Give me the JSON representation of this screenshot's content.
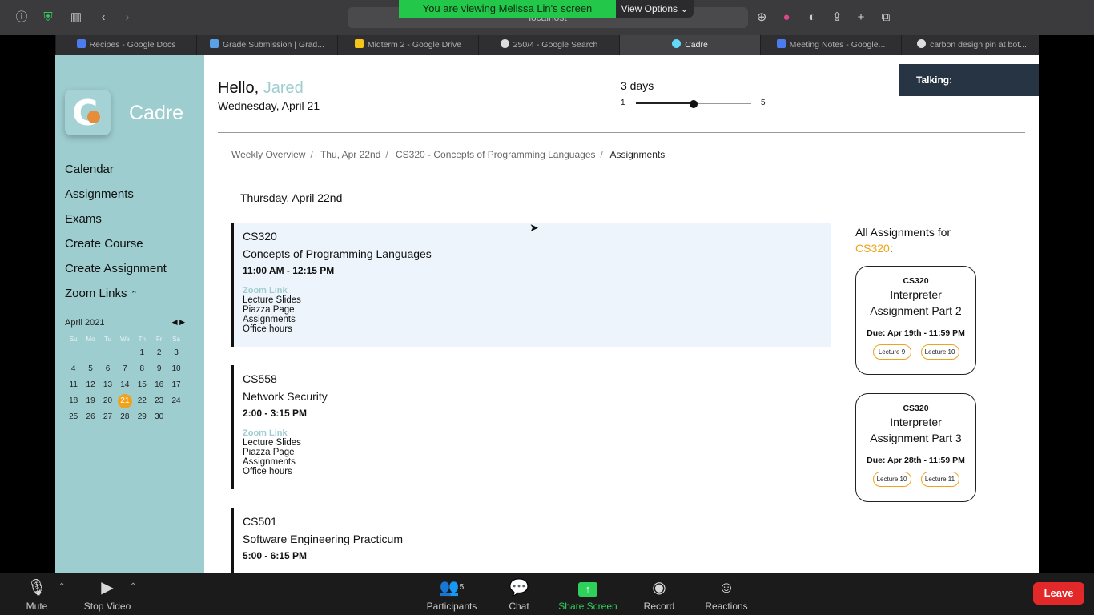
{
  "browser": {
    "url": "localhost",
    "tabs": [
      {
        "label": "Recipes - Google Docs",
        "color": "#4b7bec"
      },
      {
        "label": "Grade Submission | Grad...",
        "color": "#5aa0e6"
      },
      {
        "label": "Midterm 2 - Google Drive",
        "color": "#f5c518"
      },
      {
        "label": "250/4 - Google Search",
        "color": "#dddddd"
      },
      {
        "label": "Cadre",
        "color": "#61dafb"
      },
      {
        "label": "Meeting Notes - Google...",
        "color": "#4b7bec"
      },
      {
        "label": "carbon design pin at bot...",
        "color": "#dddddd"
      }
    ]
  },
  "share_banner": {
    "text": "You are viewing Melissa Lin's screen",
    "view_options": "View Options"
  },
  "app": {
    "brand": "Cadre",
    "greeting": "Hello,",
    "user": "Jared",
    "date": "Wednesday, April 21",
    "days_label": "3 days",
    "slider": {
      "min": "1",
      "max": "5",
      "value": 3
    },
    "talking": "Talking:",
    "nav": [
      "Calendar",
      "Assignments",
      "Exams",
      "Create Course",
      "Create Assignment",
      "Zoom Links"
    ],
    "calendar": {
      "month": "April 2021",
      "weekdays": [
        "Su",
        "Mo",
        "Tu",
        "We",
        "Th",
        "Fr",
        "Sa"
      ],
      "days": [
        "",
        "",
        "",
        "",
        "1",
        "2",
        "3",
        "4",
        "5",
        "6",
        "7",
        "8",
        "9",
        "10",
        "11",
        "12",
        "13",
        "14",
        "15",
        "16",
        "17",
        "18",
        "19",
        "20",
        "21",
        "22",
        "23",
        "24",
        "25",
        "26",
        "27",
        "28",
        "29",
        "30"
      ],
      "selected": "21"
    },
    "breadcrumb": [
      "Weekly Overview",
      "Thu, Apr 22nd",
      "CS320 - Concepts of Programming Languages",
      "Assignments"
    ],
    "day_title": "Thursday, April 22nd",
    "courses": [
      {
        "code": "CS320",
        "name": "Concepts of Programming Languages",
        "time": "11:00 AM - 12:15 PM",
        "zoom": "Zoom Link",
        "links": [
          "Lecture Slides",
          "Piazza Page",
          "Assignments",
          "Office hours"
        ]
      },
      {
        "code": "CS558",
        "name": "Network Security",
        "time": "2:00 - 3:15 PM",
        "zoom": "Zoom Link",
        "links": [
          "Lecture Slides",
          "Piazza Page",
          "Assignments",
          "Office hours"
        ]
      },
      {
        "code": "CS501",
        "name": "Software Engineering Practicum",
        "time": "5:00 - 6:15 PM"
      }
    ],
    "all_assignments": {
      "prefix": "All Assignments for",
      "course": "CS320",
      "suffix": ":"
    },
    "assignments": [
      {
        "code": "CS320",
        "title1": "Interpreter",
        "title2": "Assignment Part 2",
        "due": "Due: Apr 19th - 11:59 PM",
        "lectures": [
          "Lecture 9",
          "Lecture 10"
        ]
      },
      {
        "code": "CS320",
        "title1": "Interpreter",
        "title2": "Assignment Part 3",
        "due": "Due: Apr 28th - 11:59 PM",
        "lectures": [
          "Lecture 10",
          "Lecture 11"
        ]
      }
    ]
  },
  "zoom": {
    "mute": "Mute",
    "stop_video": "Stop Video",
    "participants": "Participants",
    "participants_count": "5",
    "chat": "Chat",
    "share": "Share Screen",
    "record": "Record",
    "reactions": "Reactions",
    "leave": "Leave"
  }
}
